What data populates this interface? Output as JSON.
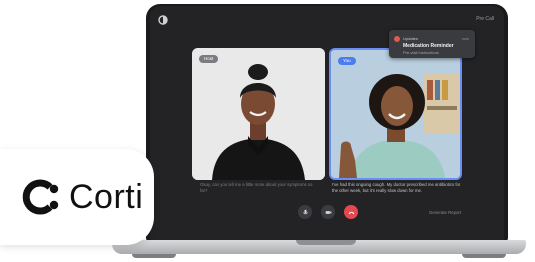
{
  "app": {
    "logo_icon": "app-logo-icon",
    "top_right_label": "Pre Call"
  },
  "participants": {
    "left_tag": "Host",
    "right_tag": "You"
  },
  "notification": {
    "app_name": "Updates",
    "time": "now",
    "title": "Medication Reminder",
    "subtitle": "Pre-visit instructions"
  },
  "captions": {
    "left": "Okay, can you tell me a little more about your symptoms so far?",
    "right": "I've had this ongoing cough. My doctor prescribed me antibiotics for the other week, but it's really slow down for me."
  },
  "controls": {
    "mic_icon": "microphone-icon",
    "camera_icon": "camera-icon",
    "end_icon": "end-call-icon",
    "end_call_color": "#e5484d",
    "report_label": "Generate Report"
  },
  "badge": {
    "brand_name": "Corti",
    "logo_icon": "corti-logo-icon"
  }
}
